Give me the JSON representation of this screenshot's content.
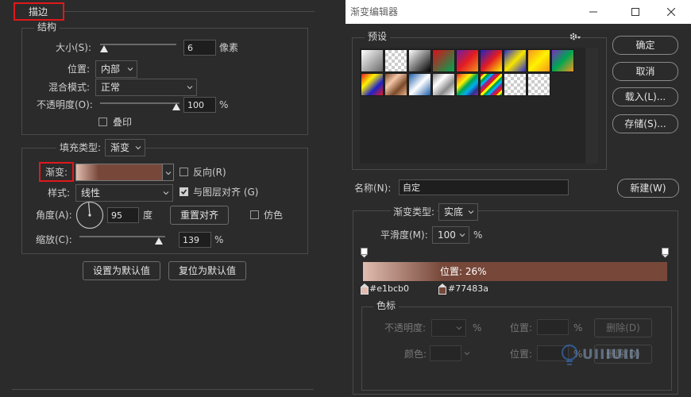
{
  "stroke_panel": {
    "section_title": "描边",
    "structure": {
      "legend": "结构",
      "size_label": "大小(S):",
      "size_value": "6",
      "size_unit": "像素",
      "position_label": "位置:",
      "position_value": "内部",
      "blend_label": "混合模式:",
      "blend_value": "正常",
      "opacity_label": "不透明度(O):",
      "opacity_value": "100",
      "opacity_unit": "%",
      "overprint_label": "叠印"
    },
    "fill": {
      "fill_type_label": "填充类型:",
      "fill_type_value": "渐变",
      "gradient_label": "渐变:",
      "reverse_label": "反向(R)",
      "style_label": "样式:",
      "style_value": "线性",
      "align_label": "与图层对齐 (G)",
      "angle_label": "角度(A):",
      "angle_value": "95",
      "angle_unit": "度",
      "reset_align_label": "重置对齐",
      "dither_label": "仿色",
      "scale_label": "缩放(C):",
      "scale_value": "139",
      "scale_unit": "%"
    },
    "set_default_label": "设置为默认值",
    "reset_default_label": "复位为默认值"
  },
  "gradient_editor": {
    "title": "渐变编辑器",
    "presets_legend": "预设",
    "ok_label": "确定",
    "cancel_label": "取消",
    "load_label": "载入(L)...",
    "save_label": "存储(S)...",
    "name_label": "名称(N):",
    "name_value": "自定",
    "new_label": "新建(W)",
    "gradient_type_label": "渐变类型:",
    "gradient_type_value": "实底",
    "smoothness_label": "平滑度(M):",
    "smoothness_value": "100",
    "smoothness_unit": "%",
    "location_readout": "位置: 26%",
    "stop_left_color": "#e1bcb0",
    "stop_right_color": "#77483a",
    "color_stops": {
      "legend": "色标",
      "opacity_label": "不透明度:",
      "opacity_unit": "%",
      "location_label_1": "位置:",
      "location_unit_1": "%",
      "delete_label_1": "删除(D)",
      "color_label": "颜色:",
      "location_label_2": "位置:",
      "location_unit_2": "%",
      "delete_label_2": "删除(D)"
    }
  },
  "colors": {
    "background": "#2b2b2b",
    "highlight": "#e0181b",
    "gradient_start": "#e1bcb0",
    "gradient_end": "#77483a"
  },
  "icons": {
    "gear": "gear-icon",
    "minimize": "minimize-icon",
    "maximize": "maximize-icon",
    "close": "close-icon",
    "chevron": "chevron-down-icon"
  }
}
